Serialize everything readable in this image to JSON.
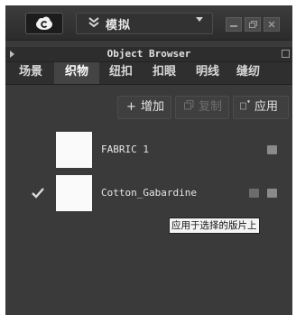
{
  "toolbar": {
    "logo_icon": "cloud-logo-icon",
    "mode_icon": "double-chevron-down-icon",
    "mode_label": "模拟",
    "dropdown_icon": "caret-down-icon",
    "window_buttons": [
      "minimize-icon",
      "restore-icon",
      "close-icon"
    ]
  },
  "browser": {
    "title": "Object Browser"
  },
  "tabs": [
    {
      "label": "场景",
      "active": false
    },
    {
      "label": "织物",
      "active": true
    },
    {
      "label": "纽扣",
      "active": false
    },
    {
      "label": "扣眼",
      "active": false
    },
    {
      "label": "明线",
      "active": false
    },
    {
      "label": "缝纫",
      "active": false
    }
  ],
  "actions": {
    "add_label": "增加",
    "add_icon": "plus-icon",
    "copy_label": "复制",
    "copy_icon": "copy-icon",
    "apply_label": "应用",
    "apply_icon": "apply-icon"
  },
  "fabrics": [
    {
      "name": "FABRIC 1",
      "selected": false,
      "swatch_color": "#fafafa"
    },
    {
      "name": "Cotton_Gabardine",
      "selected": true,
      "swatch_color": "#fafafa"
    }
  ],
  "tooltip": "应用于选择的版片上",
  "colors": {
    "panel_bg": "#3a3a3a",
    "active_tab": "#444444",
    "text": "#e6e6e6"
  }
}
